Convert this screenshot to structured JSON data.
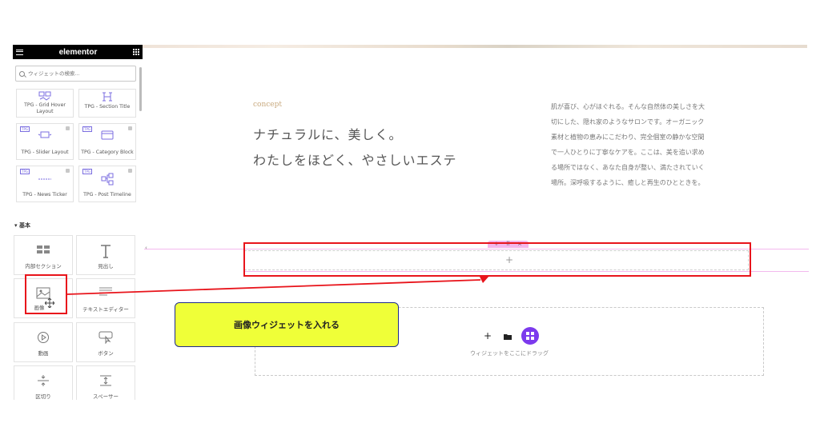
{
  "editor": {
    "logo": "elementor",
    "search_placeholder": "ウィジェットの検索..."
  },
  "tpg_widgets": [
    {
      "label": "TPG - Grid Hover Layout",
      "icon": "grid-hover-icon",
      "locked": false
    },
    {
      "label": "TPG - Section Title",
      "icon": "section-title-icon",
      "locked": false
    },
    {
      "label": "TPG - Slider Layout",
      "icon": "slider-icon",
      "locked": true,
      "badge": "TPG"
    },
    {
      "label": "TPG - Category Block",
      "icon": "category-block-icon",
      "locked": true,
      "badge": "TPG"
    },
    {
      "label": "TPG - News Ticker",
      "icon": "news-ticker-icon",
      "locked": true,
      "badge": "TPG"
    },
    {
      "label": "TPG - Post Timeline",
      "icon": "timeline-icon",
      "locked": true,
      "badge": "TPG"
    }
  ],
  "basic_section": {
    "title": "基本",
    "widgets": [
      {
        "label": "内部セクション",
        "icon": "inner-section-icon"
      },
      {
        "label": "見出し",
        "icon": "heading-icon"
      },
      {
        "label": "画像",
        "icon": "image-icon"
      },
      {
        "label": "テキストエディター",
        "icon": "text-editor-icon"
      },
      {
        "label": "動画",
        "icon": "video-icon"
      },
      {
        "label": "ボタン",
        "icon": "button-icon"
      },
      {
        "label": "区切り",
        "icon": "divider-icon"
      },
      {
        "label": "スペーサー",
        "icon": "spacer-icon"
      }
    ]
  },
  "page": {
    "concept_label": "concept",
    "headline_1": "ナチュラルに、美しく。",
    "headline_2": "わたしをほどく、やさしいエステ",
    "body_lines": [
      "肌が喜び、心がほぐれる。そんな自然体の美しさを大",
      "切にした、隠れ家のようなサロンです。オーガニック",
      "素材と植物の恵みにこだわり、完全個室の静かな空間",
      "で一人ひとりに丁寧なケアを。ここは、美を追い求め",
      "る場所ではなく、あなた自身が整い、満たされていく",
      "場所。深呼吸するように、癒しと再生のひとときを。"
    ]
  },
  "section_toolbar": {
    "add": "+",
    "move": "⠿",
    "close": "×"
  },
  "empty_section_plus": "+",
  "drop_area": {
    "hint": "ウィジェットをここにドラッグ"
  },
  "callout": {
    "text": "画像ウィジェットを入れる"
  },
  "colors": {
    "annotation_red": "#e8141b",
    "callout_yellow": "#efff38",
    "elementor_purple": "#7c3aed",
    "section_pink": "#f3b9ee"
  }
}
